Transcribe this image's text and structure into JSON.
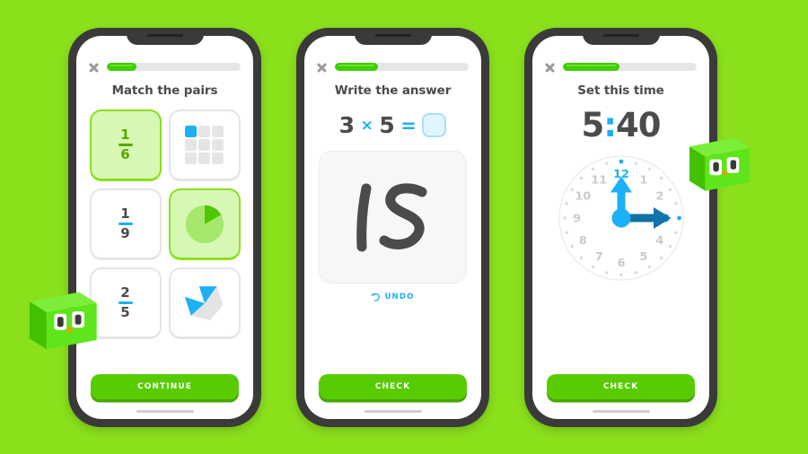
{
  "theme": {
    "background": "#8BE01C",
    "brand_green": "#58CC02",
    "brand_blue": "#1CB0F6",
    "text_gray": "#4B4B4B"
  },
  "screens": [
    {
      "id": "match-the-pairs",
      "close_icon": "close-icon",
      "progress_percent": 22,
      "title": "Match the pairs",
      "cards": [
        {
          "type": "fraction",
          "numerator": "1",
          "denominator": "6",
          "selected": true
        },
        {
          "type": "grid",
          "total": 9,
          "filled": 1,
          "selected": false
        },
        {
          "type": "fraction",
          "numerator": "1",
          "denominator": "9",
          "selected": false
        },
        {
          "type": "pie",
          "total": 6,
          "filled": 1,
          "selected": true
        },
        {
          "type": "fraction",
          "numerator": "2",
          "denominator": "5",
          "selected": false
        },
        {
          "type": "pentagon",
          "total": 5,
          "filled": 2,
          "selected": false
        }
      ],
      "cta_label": "CONTINUE"
    },
    {
      "id": "write-the-answer",
      "close_icon": "close-icon",
      "progress_percent": 32,
      "title": "Write the answer",
      "equation": {
        "left": "3",
        "operator": "×",
        "right": "5",
        "equals": "=",
        "answer_value": ""
      },
      "handwriting": "15",
      "undo_label": "UNDO",
      "undo_icon": "undo-arrow-icon",
      "cta_label": "CHECK"
    },
    {
      "id": "set-this-time",
      "close_icon": "close-icon",
      "progress_percent": 42,
      "title": "Set this time",
      "digital_time": {
        "hours": "5",
        "colon": ":",
        "minutes": "40"
      },
      "clock": {
        "numbers": [
          "12",
          "1",
          "2",
          "3",
          "4",
          "5",
          "6",
          "7",
          "8",
          "9",
          "10",
          "11"
        ],
        "highlighted_numbers": [
          "12",
          "3"
        ],
        "hour_hand_points_to": "12",
        "minute_hand_points_to": "3"
      },
      "cta_label": "CHECK"
    }
  ],
  "mascots": [
    {
      "name": "duo-owl-cube-left",
      "position": "left"
    },
    {
      "name": "duo-owl-cube-right",
      "position": "right"
    }
  ]
}
